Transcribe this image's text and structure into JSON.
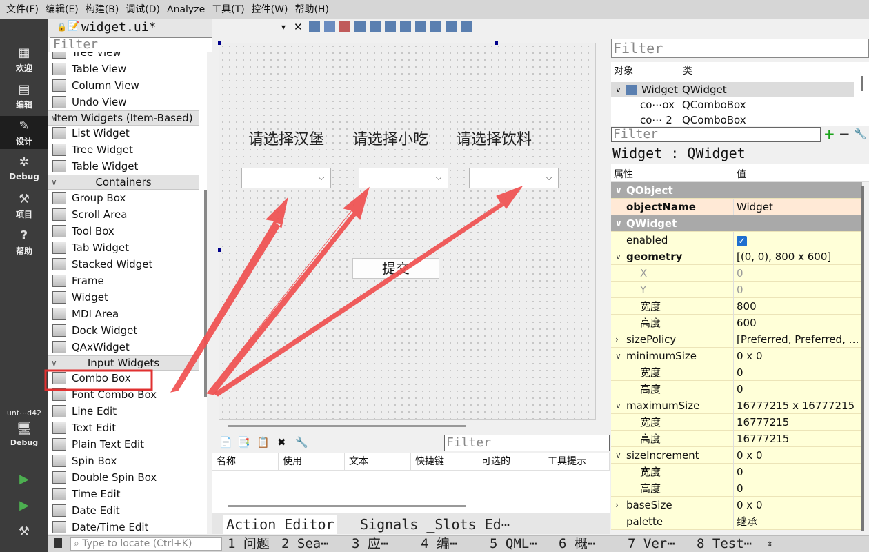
{
  "menubar": [
    "文件(F)",
    "编辑(E)",
    "构建(B)",
    "调试(D)",
    "Analyze",
    "工具(T)",
    "控件(W)",
    "帮助(H)"
  ],
  "modes": [
    {
      "label": "欢迎",
      "icon": "grid-icon"
    },
    {
      "label": "编辑",
      "icon": "document-icon"
    },
    {
      "label": "设计",
      "icon": "pencil-icon"
    },
    {
      "label": "Debug",
      "icon": "bug-icon"
    },
    {
      "label": "项目",
      "icon": "wrench-icon"
    },
    {
      "label": "帮助",
      "icon": "help-icon"
    }
  ],
  "kit": {
    "name": "unt⋯d42",
    "mode": "Debug"
  },
  "doc_tab": "widget.ui*",
  "filter_placeholder": "Filter",
  "widgetbox": {
    "partial_top": "Tree View",
    "items_a": [
      "Table View",
      "Column View",
      "Undo View"
    ],
    "cat_item_widgets": "Item Widgets (Item-Based)",
    "items_b": [
      "List Widget",
      "Tree Widget",
      "Table Widget"
    ],
    "cat_containers": "Containers",
    "items_c": [
      "Group Box",
      "Scroll Area",
      "Tool Box",
      "Tab Widget",
      "Stacked Widget",
      "Frame",
      "Widget",
      "MDI Area",
      "Dock Widget",
      "QAxWidget"
    ],
    "cat_input": "Input Widgets",
    "items_d": [
      "Combo Box",
      "Font Combo Box",
      "Line Edit",
      "Text Edit",
      "Plain Text Edit",
      "Spin Box",
      "Double Spin Box",
      "Time Edit",
      "Date Edit",
      "Date/Time Edit"
    ]
  },
  "form": {
    "labels": [
      "请选择汉堡",
      "请选择小吃",
      "请选择饮料"
    ],
    "submit": "提交"
  },
  "action_editor": {
    "columns": [
      "名称",
      "使用",
      "文本",
      "快捷键",
      "可选的",
      "工具提示"
    ],
    "tabs": [
      "Action Editor",
      "Signals _Slots Ed⋯"
    ]
  },
  "object_inspector": {
    "columns": [
      "对象",
      "类"
    ],
    "rows": [
      {
        "obj": "Widget",
        "cls": "QWidget"
      },
      {
        "obj": "co⋯ox",
        "cls": "QComboBox"
      },
      {
        "obj": "co⋯ 2",
        "cls": "QComboBox"
      }
    ]
  },
  "property_editor": {
    "title": "Widget : QWidget",
    "columns": [
      "属性",
      "值"
    ],
    "rows": [
      {
        "t": "sect",
        "n": "QObject"
      },
      {
        "n": "objectName",
        "v": "Widget",
        "bold": true
      },
      {
        "t": "sect",
        "n": "QWidget"
      },
      {
        "n": "enabled",
        "v": "✓",
        "check": true
      },
      {
        "n": "geometry",
        "v": "[(0, 0), 800 x 600]",
        "bold": true,
        "exp": "open"
      },
      {
        "n": "X",
        "v": "0",
        "sub": true,
        "dim": true
      },
      {
        "n": "Y",
        "v": "0",
        "sub": true,
        "dim": true
      },
      {
        "n": "宽度",
        "v": "800",
        "sub": true
      },
      {
        "n": "高度",
        "v": "600",
        "sub": true
      },
      {
        "n": "sizePolicy",
        "v": "[Preferred, Preferred, …",
        "exp": "closed"
      },
      {
        "n": "minimumSize",
        "v": "0 x 0",
        "exp": "open"
      },
      {
        "n": "宽度",
        "v": "0",
        "sub": true
      },
      {
        "n": "高度",
        "v": "0",
        "sub": true
      },
      {
        "n": "maximumSize",
        "v": "16777215 x 16777215",
        "exp": "open"
      },
      {
        "n": "宽度",
        "v": "16777215",
        "sub": true
      },
      {
        "n": "高度",
        "v": "16777215",
        "sub": true
      },
      {
        "n": "sizeIncrement",
        "v": "0 x 0",
        "exp": "open"
      },
      {
        "n": "宽度",
        "v": "0",
        "sub": true
      },
      {
        "n": "高度",
        "v": "0",
        "sub": true
      },
      {
        "n": "baseSize",
        "v": "0 x 0",
        "exp": "closed"
      },
      {
        "n": "palette",
        "v": "继承"
      }
    ]
  },
  "statusbar": {
    "locate_placeholder": "Type to locate (Ctrl+K)",
    "tabs": [
      "1 问题",
      "2 Sea⋯",
      "3 应⋯",
      "4 编⋯",
      "5 QML⋯",
      "6 概⋯",
      "7 Ver⋯",
      "8 Test⋯"
    ]
  },
  "accent": {
    "arrow": "#f05050",
    "highlight": "#e03030",
    "section": "#a9a9a9",
    "row_bg": "#ffffd8",
    "row_obj": "#ffe9d6"
  }
}
